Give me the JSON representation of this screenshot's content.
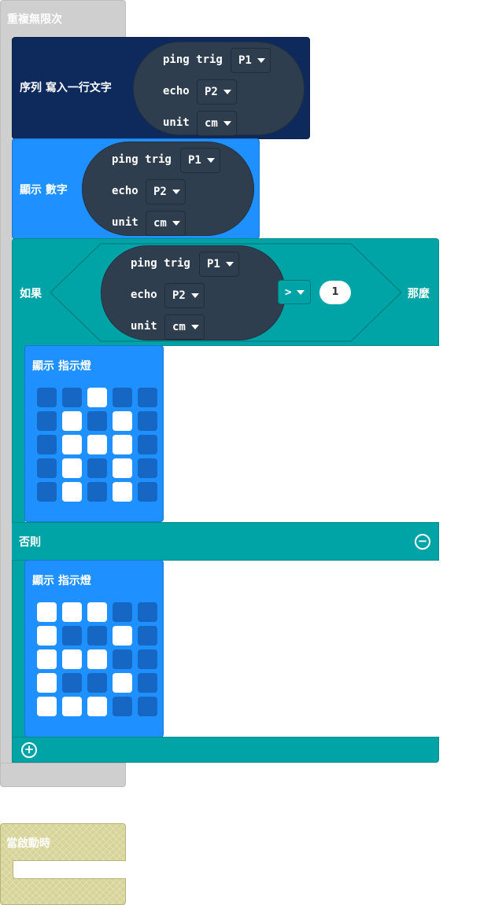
{
  "forever": {
    "label": "重複無限次"
  },
  "serial": {
    "label": "序列 寫入一行文字",
    "ping": {
      "trig_label": "ping trig",
      "trig_value": "P1",
      "echo_label": "echo",
      "echo_value": "P2",
      "unit_label": "unit",
      "unit_value": "cm"
    }
  },
  "show_number": {
    "label": "顯示 數字",
    "ping": {
      "trig_label": "ping trig",
      "trig_value": "P1",
      "echo_label": "echo",
      "echo_value": "P2",
      "unit_label": "unit",
      "unit_value": "cm"
    }
  },
  "if_block": {
    "if_label": "如果",
    "then_label": "那麼",
    "else_label": "否則",
    "ping": {
      "trig_label": "ping trig",
      "trig_value": "P1",
      "echo_label": "echo",
      "echo_value": "P2",
      "unit_label": "unit",
      "unit_value": "cm"
    },
    "operator": ">",
    "compare_value": "1",
    "minus_icon": "minus-circle-icon",
    "plus_icon": "plus-circle-icon"
  },
  "show_leds_1": {
    "label": "顯示 指示燈",
    "grid": [
      [
        0,
        0,
        1,
        0,
        0
      ],
      [
        0,
        1,
        0,
        1,
        0
      ],
      [
        0,
        1,
        1,
        1,
        0
      ],
      [
        0,
        1,
        0,
        1,
        0
      ],
      [
        0,
        1,
        0,
        1,
        0
      ]
    ]
  },
  "show_leds_2": {
    "label": "顯示 指示燈",
    "grid": [
      [
        1,
        1,
        1,
        0,
        0
      ],
      [
        1,
        0,
        0,
        1,
        0
      ],
      [
        1,
        1,
        1,
        0,
        0
      ],
      [
        1,
        0,
        0,
        1,
        0
      ],
      [
        1,
        1,
        1,
        0,
        0
      ]
    ]
  },
  "on_start": {
    "label": "當啟動時"
  },
  "colors": {
    "loop_gray": "#cfcfcf",
    "serial_navy": "#0e2a5c",
    "basic_blue": "#1e90ff",
    "logic_teal": "#00a4a6",
    "sonar_dark": "#2f3e4e",
    "led_on": "#ffffff",
    "led_off": "#1666c4",
    "start_khaki": "#d7d49a"
  }
}
